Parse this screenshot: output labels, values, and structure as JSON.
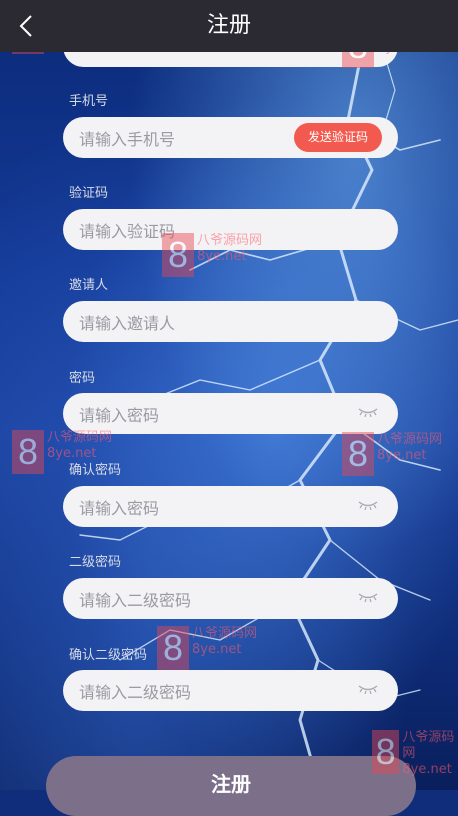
{
  "header": {
    "title": "注册"
  },
  "fields": [
    {
      "label": "手机号",
      "placeholder": "请输入手机号",
      "action": "发送验证码"
    },
    {
      "label": "验证码",
      "placeholder": "请输入验证码"
    },
    {
      "label": "邀请人",
      "placeholder": "请输入邀请人"
    },
    {
      "label": "密码",
      "placeholder": "请输入密码"
    },
    {
      "label": "确认密码",
      "placeholder": "请输入密码"
    },
    {
      "label": "二级密码",
      "placeholder": "请输入二级密码"
    },
    {
      "label": "确认二级密码",
      "placeholder": "请输入二级密码"
    }
  ],
  "submit_label": "注册",
  "watermark": {
    "num": "8",
    "cn": "八爷源码网",
    "url": "8ye.net"
  },
  "colors": {
    "accent": "#f35a4f",
    "header": "#2b2a33"
  }
}
